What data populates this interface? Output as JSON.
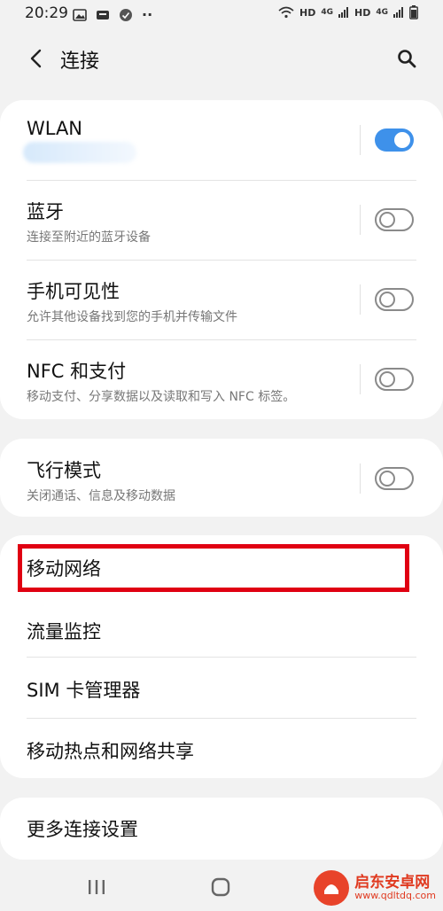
{
  "status_bar": {
    "time": "20:29",
    "network_labels": [
      "HD",
      "4G",
      "HD",
      "4G"
    ],
    "more_indicator": "··"
  },
  "header": {
    "title": "连接"
  },
  "connections": {
    "wlan": {
      "title": "WLAN",
      "enabled": true
    },
    "bluetooth": {
      "title": "蓝牙",
      "subtitle": "连接至附近的蓝牙设备",
      "enabled": false
    },
    "visibility": {
      "title": "手机可见性",
      "subtitle": "允许其他设备找到您的手机并传输文件",
      "enabled": false
    },
    "nfc": {
      "title": "NFC 和支付",
      "subtitle": "移动支付、分享数据以及读取和写入 NFC 标签。",
      "enabled": false
    }
  },
  "airplane": {
    "title": "飞行模式",
    "subtitle": "关闭通话、信息及移动数据",
    "enabled": false
  },
  "network_items": [
    {
      "title": "移动网络"
    },
    {
      "title": "流量监控"
    },
    {
      "title": "SIM 卡管理器"
    },
    {
      "title": "移动热点和网络共享"
    }
  ],
  "more": {
    "title": "更多连接设置"
  },
  "watermark": {
    "name": "启东安卓网",
    "url": "www.qdltdq.com"
  },
  "colors": {
    "toggle_on": "#3e91ea",
    "highlight": "#e00012",
    "watermark": "#e03a20"
  }
}
